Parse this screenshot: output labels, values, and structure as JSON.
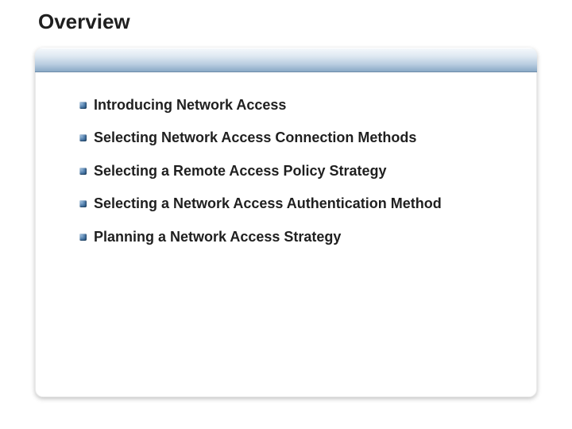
{
  "title": "Overview",
  "bullets": [
    "Introducing Network Access",
    "Selecting Network Access Connection Methods",
    "Selecting a Remote Access Policy Strategy",
    "Selecting a Network Access Authentication Method",
    "Planning a Network Access Strategy"
  ]
}
